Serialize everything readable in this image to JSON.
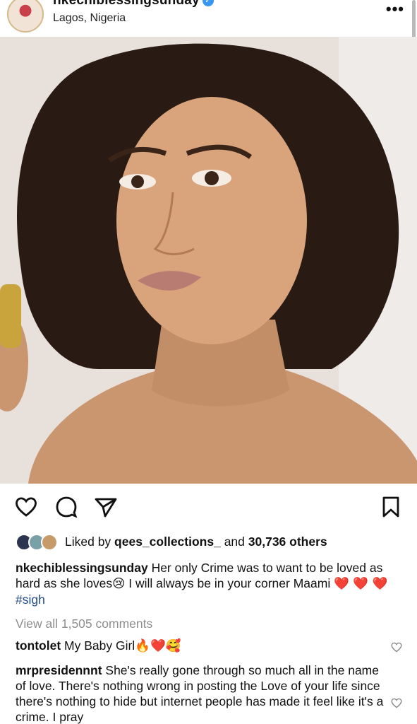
{
  "post": {
    "username": "nkechiblessingsunday",
    "location": "Lagos, Nigeria",
    "more_label": "•••"
  },
  "icons": {
    "verified": "verified-badge-icon",
    "like": "heart-outline-icon",
    "comment": "comment-bubble-icon",
    "share": "paper-plane-icon",
    "save": "bookmark-icon",
    "comment_like": "small-heart-icon"
  },
  "likes": {
    "prefix": "Liked by ",
    "user": "qees_collections_",
    "middle": " and ",
    "count": "30,736 others"
  },
  "caption": {
    "username": "nkechiblessingsunday",
    "text": " Her only Crime was to want to be loved as hard as she loves",
    "emoji_cry": "😢",
    "text2": " I will always be in your corner Maami ",
    "hearts": "❤️ ❤️ ❤️",
    "hashtag": "#sigh"
  },
  "view_all": "View all 1,505 comments",
  "comments": [
    {
      "username": "tontolet",
      "text": " My Baby Girl",
      "emojis": "🔥❤️🥰"
    },
    {
      "username": "mrpresidennnt",
      "text": " She's really gone through so much all in the name of love. There's nothing wrong in posting the Love of your life since there's nothing to hide but internet people has made it feel like it's a crime. I pray"
    }
  ],
  "colors": {
    "hashtag": "#1f4a8a",
    "muted": "#8e8e8e",
    "verified": "#3897f0",
    "heart": "#e0242f"
  }
}
